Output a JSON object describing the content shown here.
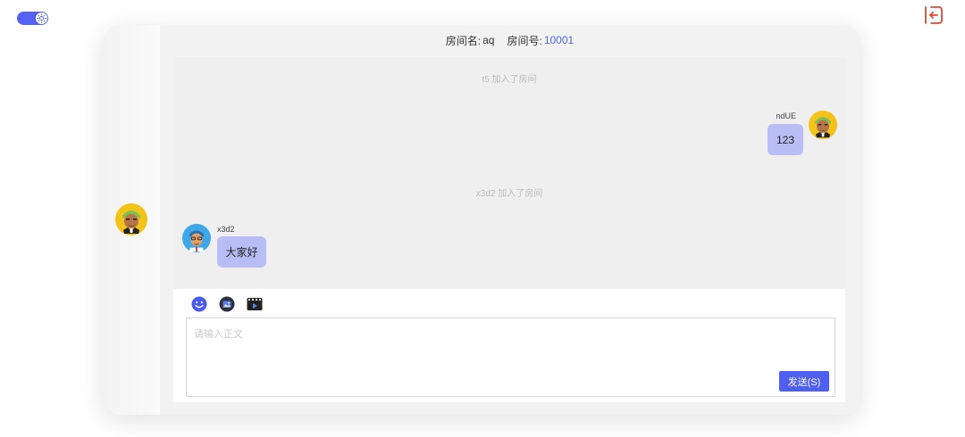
{
  "theme_toggle": {
    "state": "on",
    "icon": "sun-icon",
    "color": "#5561f2"
  },
  "logout": {
    "icon": "logout-icon",
    "color": "#e0472e"
  },
  "header": {
    "room_name_label": "房间名:",
    "room_name": "aq",
    "room_id_label": "房间号:",
    "room_id": "10001",
    "accent": "#4a67e6"
  },
  "messages": [
    {
      "type": "system",
      "text": "t5 加入了房间"
    },
    {
      "type": "chat",
      "side": "right",
      "user": "ndUE",
      "text": "123",
      "avatar": "avatar-yellow-hair"
    },
    {
      "type": "system",
      "text": "x3d2 加入了房间"
    },
    {
      "type": "chat",
      "side": "left",
      "user": "x3d2",
      "text": "大家好",
      "avatar": "avatar-blue-hair"
    }
  ],
  "composer": {
    "tools": [
      {
        "icon": "emoji-icon",
        "label": "emoji"
      },
      {
        "icon": "image-icon",
        "label": "image"
      },
      {
        "icon": "video-icon",
        "label": "video"
      }
    ],
    "placeholder": "请输入正文",
    "value": "",
    "send_label": "发送(S)",
    "send_color": "#4f5ff0"
  }
}
